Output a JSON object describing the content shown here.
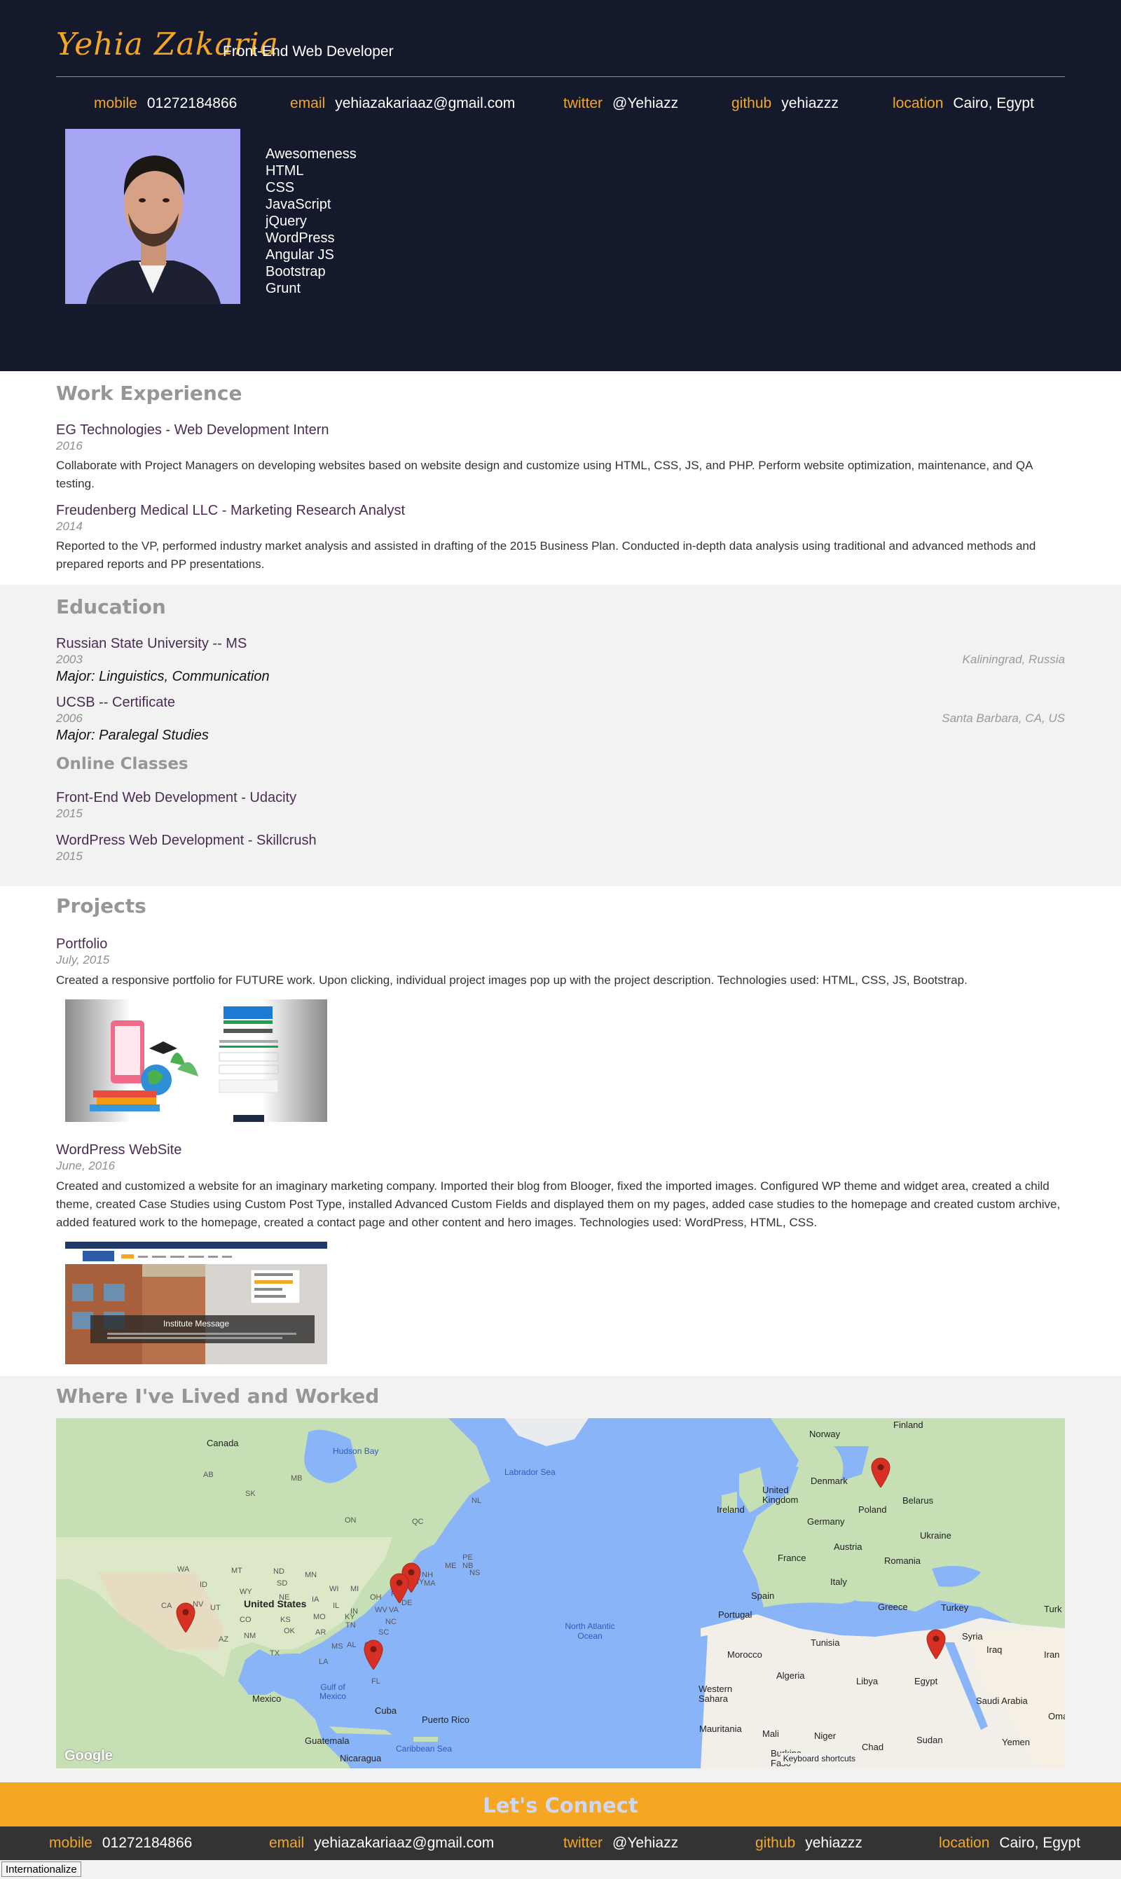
{
  "header": {
    "name": "Yehia Zakaria",
    "role": "Front-End Web Developer",
    "contacts": [
      {
        "key": "mobile",
        "value": "01272184866"
      },
      {
        "key": "email",
        "value": "yehiazakariaaz@gmail.com"
      },
      {
        "key": "twitter",
        "value": "@Yehiazz"
      },
      {
        "key": "github",
        "value": "yehiazzz"
      },
      {
        "key": "location",
        "value": "Cairo, Egypt"
      }
    ],
    "skills": [
      "Awesomeness",
      "HTML",
      "CSS",
      "JavaScript",
      "jQuery",
      "WordPress",
      "Angular JS",
      "Bootstrap",
      "Grunt"
    ]
  },
  "work": {
    "title": "Work Experience",
    "jobs": [
      {
        "title": "EG Technologies - Web Development Intern",
        "date": "2016",
        "desc": "Collaborate with Project Managers on developing websites based on website design and customize using HTML, CSS, JS, and PHP. Perform website optimization, maintenance, and QA testing."
      },
      {
        "title": "Freudenberg Medical LLC - Marketing Research Analyst",
        "date": "2014",
        "desc": "Reported to the VP, performed industry market analysis and assisted in drafting of the 2015 Business Plan. Conducted in-depth data analysis using traditional and advanced methods and prepared reports and PP presentations."
      }
    ]
  },
  "education": {
    "title": "Education",
    "schools": [
      {
        "title": "Russian State University -- MS",
        "date": "2003",
        "major": "Major: Linguistics, Communication",
        "location": "Kaliningrad, Russia"
      },
      {
        "title": "UCSB -- Certificate",
        "date": "2006",
        "major": "Major: Paralegal Studies",
        "location": "Santa Barbara, CA, US"
      }
    ],
    "online_title": "Online Classes",
    "online": [
      {
        "title": "Front-End Web Development - Udacity",
        "date": "2015"
      },
      {
        "title": "WordPress Web Development - Skillcrush",
        "date": "2015"
      }
    ]
  },
  "projects": {
    "title": "Projects",
    "items": [
      {
        "title": "Portfolio",
        "date": "July, 2015",
        "desc": "Created a responsive portfolio for FUTURE work. Upon clicking, individual project images pop up with the project description. Technologies used: HTML, CSS, JS, Bootstrap."
      },
      {
        "title": "WordPress WebSite",
        "date": "June, 2016",
        "desc": "Created and customized a website for an imaginary marketing company. Imported their blog from Blooger, fixed the imported images. Configured WP theme and widget area, created a child theme, created Case Studies using Custom Post Type, installed Advanced Custom Fields and displayed them on my pages, added case studies to the homepage and created custom archive, added featured work to the homepage, created a contact page and other content and hero images. Technologies used: WordPress, HTML, CSS.",
        "screenshot_caption": "Institute Message"
      }
    ]
  },
  "places": {
    "title": "Where I've Lived and Worked",
    "map_labels": {
      "countries": [
        "Canada",
        "United States",
        "Mexico",
        "Cuba",
        "Guatemala",
        "Nicaragua",
        "Puerto Rico",
        "Norway",
        "Finland",
        "Denmark",
        "United Kingdom",
        "Ireland",
        "Poland",
        "Belarus",
        "Germany",
        "Ukraine",
        "France",
        "Austria",
        "Romania",
        "Italy",
        "Spain",
        "Portugal",
        "Greece",
        "Turkey",
        "Tunisia",
        "Syria",
        "Iraq",
        "Iran",
        "Morocco",
        "Algeria",
        "Libya",
        "Egypt",
        "Saudi Arabia",
        "Western Sahara",
        "Mauritania",
        "Mali",
        "Niger",
        "Chad",
        "Sudan",
        "Yemen",
        "Burkina Faso",
        "Oma",
        "Turk"
      ],
      "waters": [
        "Hudson Bay",
        "Labrador Sea",
        "North Atlantic Ocean",
        "Gulf of Mexico",
        "Caribbean Sea"
      ],
      "regions": [
        "AB",
        "MB",
        "SK",
        "ON",
        "QC",
        "NL",
        "NB",
        "PE",
        "NS",
        "ME",
        "WA",
        "MT",
        "ND",
        "MN",
        "ID",
        "SD",
        "WI",
        "WY",
        "NE",
        "IA",
        "MI",
        "NY",
        "NV",
        "UT",
        "CO",
        "KS",
        "MO",
        "IL",
        "IN",
        "OH",
        "PA",
        "NH",
        "MA",
        "CA",
        "AZ",
        "NM",
        "OK",
        "AR",
        "TN",
        "KY",
        "WV",
        "VA",
        "NC",
        "MS",
        "AL",
        "GA",
        "SC",
        "TX",
        "LA",
        "FL",
        "DE"
      ]
    },
    "pins": [
      "Santa Barbara, CA",
      "Florida",
      "Pennsylvania",
      "New Jersey",
      "Kaliningrad, Russia",
      "Cairo, Egypt"
    ],
    "google_logo": "Google",
    "keyboard_shortcuts": "Keyboard shortcuts"
  },
  "connect": {
    "title": "Let's Connect"
  },
  "footer": {
    "contacts": [
      {
        "key": "mobile",
        "value": "01272184866"
      },
      {
        "key": "email",
        "value": "yehiazakariaaz@gmail.com"
      },
      {
        "key": "twitter",
        "value": "@Yehiazz"
      },
      {
        "key": "github",
        "value": "yehiazzz"
      },
      {
        "key": "location",
        "value": "Cairo, Egypt"
      }
    ],
    "intl_button": "Internationalize"
  },
  "colors": {
    "header_bg": "#141a2b",
    "accent": "#f5a623",
    "item_title": "#4a2c52",
    "section_title": "#969696",
    "footer_bg": "#333333",
    "map_water": "#8ab4f8",
    "map_land": "#bfe0b0",
    "pin": "#d93025"
  }
}
